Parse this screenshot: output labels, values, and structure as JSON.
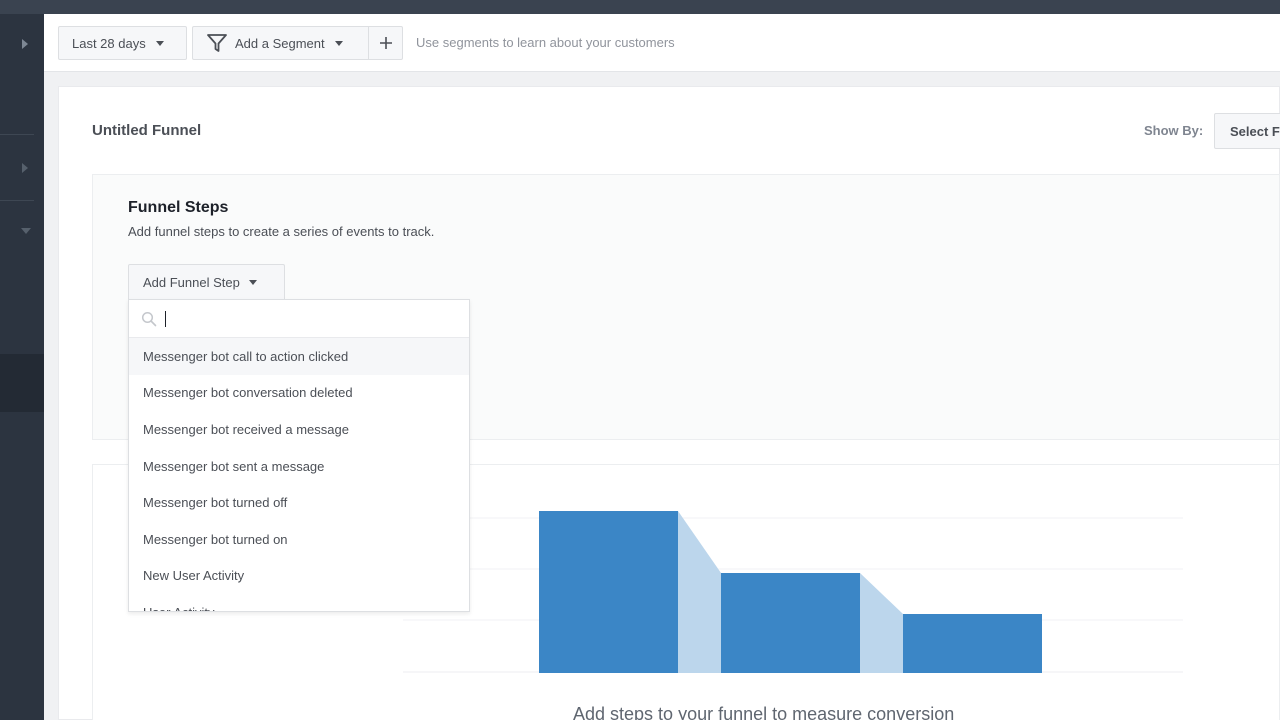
{
  "toolbar": {
    "date_range_label": "Last 28 days",
    "segment_label": "Add a Segment",
    "add_icon": "plus-icon",
    "filter_icon": "funnel-filter-icon",
    "hint": "Use segments to learn about your customers"
  },
  "funnel": {
    "title": "Untitled Funnel",
    "show_by_label": "Show By:",
    "show_by_value": "Select F"
  },
  "steps": {
    "title": "Funnel Steps",
    "description": "Add funnel steps to create a series of events to track.",
    "add_button_label": "Add Funnel Step",
    "search_value": "",
    "search_icon": "search-icon",
    "options": [
      "Messenger bot call to action clicked",
      "Messenger bot conversation deleted",
      "Messenger bot received a message",
      "Messenger bot sent a message",
      "Messenger bot turned off",
      "Messenger bot turned on",
      "New User Activity",
      "User Activity"
    ]
  },
  "placeholder_chart": {
    "caption": "Add steps to your funnel to measure conversion",
    "bar_color": "#3b86c6",
    "connector_color": "#bcd6ec"
  },
  "colors": {
    "sidebar": "#2c3440",
    "topbar": "#3a4350",
    "accent": "#3b86c6"
  }
}
